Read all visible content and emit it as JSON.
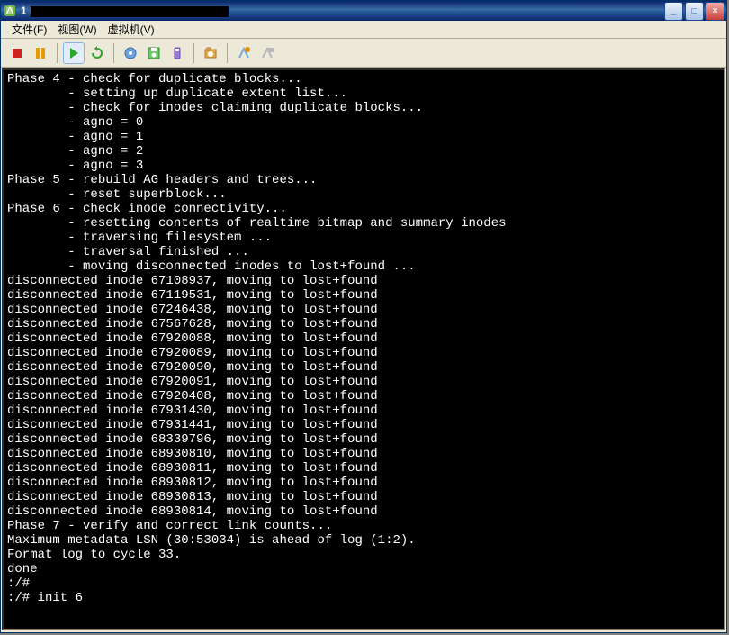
{
  "titlebar": {
    "prefix": "1"
  },
  "menu": {
    "file": "文件(F)",
    "view": "视图(W)",
    "vm": "虚拟机(V)"
  },
  "window_controls": {
    "minimize": "_",
    "maximize": "□",
    "close": "×"
  },
  "toolbar_icons": {
    "stop": "stop-icon",
    "pause": "pause-icon",
    "play": "play-icon",
    "reset": "reset-icon",
    "diskA": "disk-blue-icon",
    "diskB": "disk-green-icon",
    "diskC": "disk-purple-icon",
    "snapshot": "snapshot-icon",
    "shortcut": "shortcut-icon",
    "fullscreen": "fullscreen-icon"
  },
  "console_lines": [
    "Phase 4 - check for duplicate blocks...",
    "        - setting up duplicate extent list...",
    "        - check for inodes claiming duplicate blocks...",
    "        - agno = 0",
    "        - agno = 1",
    "        - agno = 2",
    "        - agno = 3",
    "Phase 5 - rebuild AG headers and trees...",
    "        - reset superblock...",
    "Phase 6 - check inode connectivity...",
    "        - resetting contents of realtime bitmap and summary inodes",
    "        - traversing filesystem ...",
    "        - traversal finished ...",
    "        - moving disconnected inodes to lost+found ...",
    "disconnected inode 67108937, moving to lost+found",
    "disconnected inode 67119531, moving to lost+found",
    "disconnected inode 67246438, moving to lost+found",
    "disconnected inode 67567628, moving to lost+found",
    "disconnected inode 67920088, moving to lost+found",
    "disconnected inode 67920089, moving to lost+found",
    "disconnected inode 67920090, moving to lost+found",
    "disconnected inode 67920091, moving to lost+found",
    "disconnected inode 67920408, moving to lost+found",
    "disconnected inode 67931430, moving to lost+found",
    "disconnected inode 67931441, moving to lost+found",
    "disconnected inode 68339796, moving to lost+found",
    "disconnected inode 68930810, moving to lost+found",
    "disconnected inode 68930811, moving to lost+found",
    "disconnected inode 68930812, moving to lost+found",
    "disconnected inode 68930813, moving to lost+found",
    "disconnected inode 68930814, moving to lost+found",
    "Phase 7 - verify and correct link counts...",
    "Maximum metadata LSN (30:53034) is ahead of log (1:2).",
    "Format log to cycle 33.",
    "done",
    ":/#",
    ":/# init 6"
  ]
}
